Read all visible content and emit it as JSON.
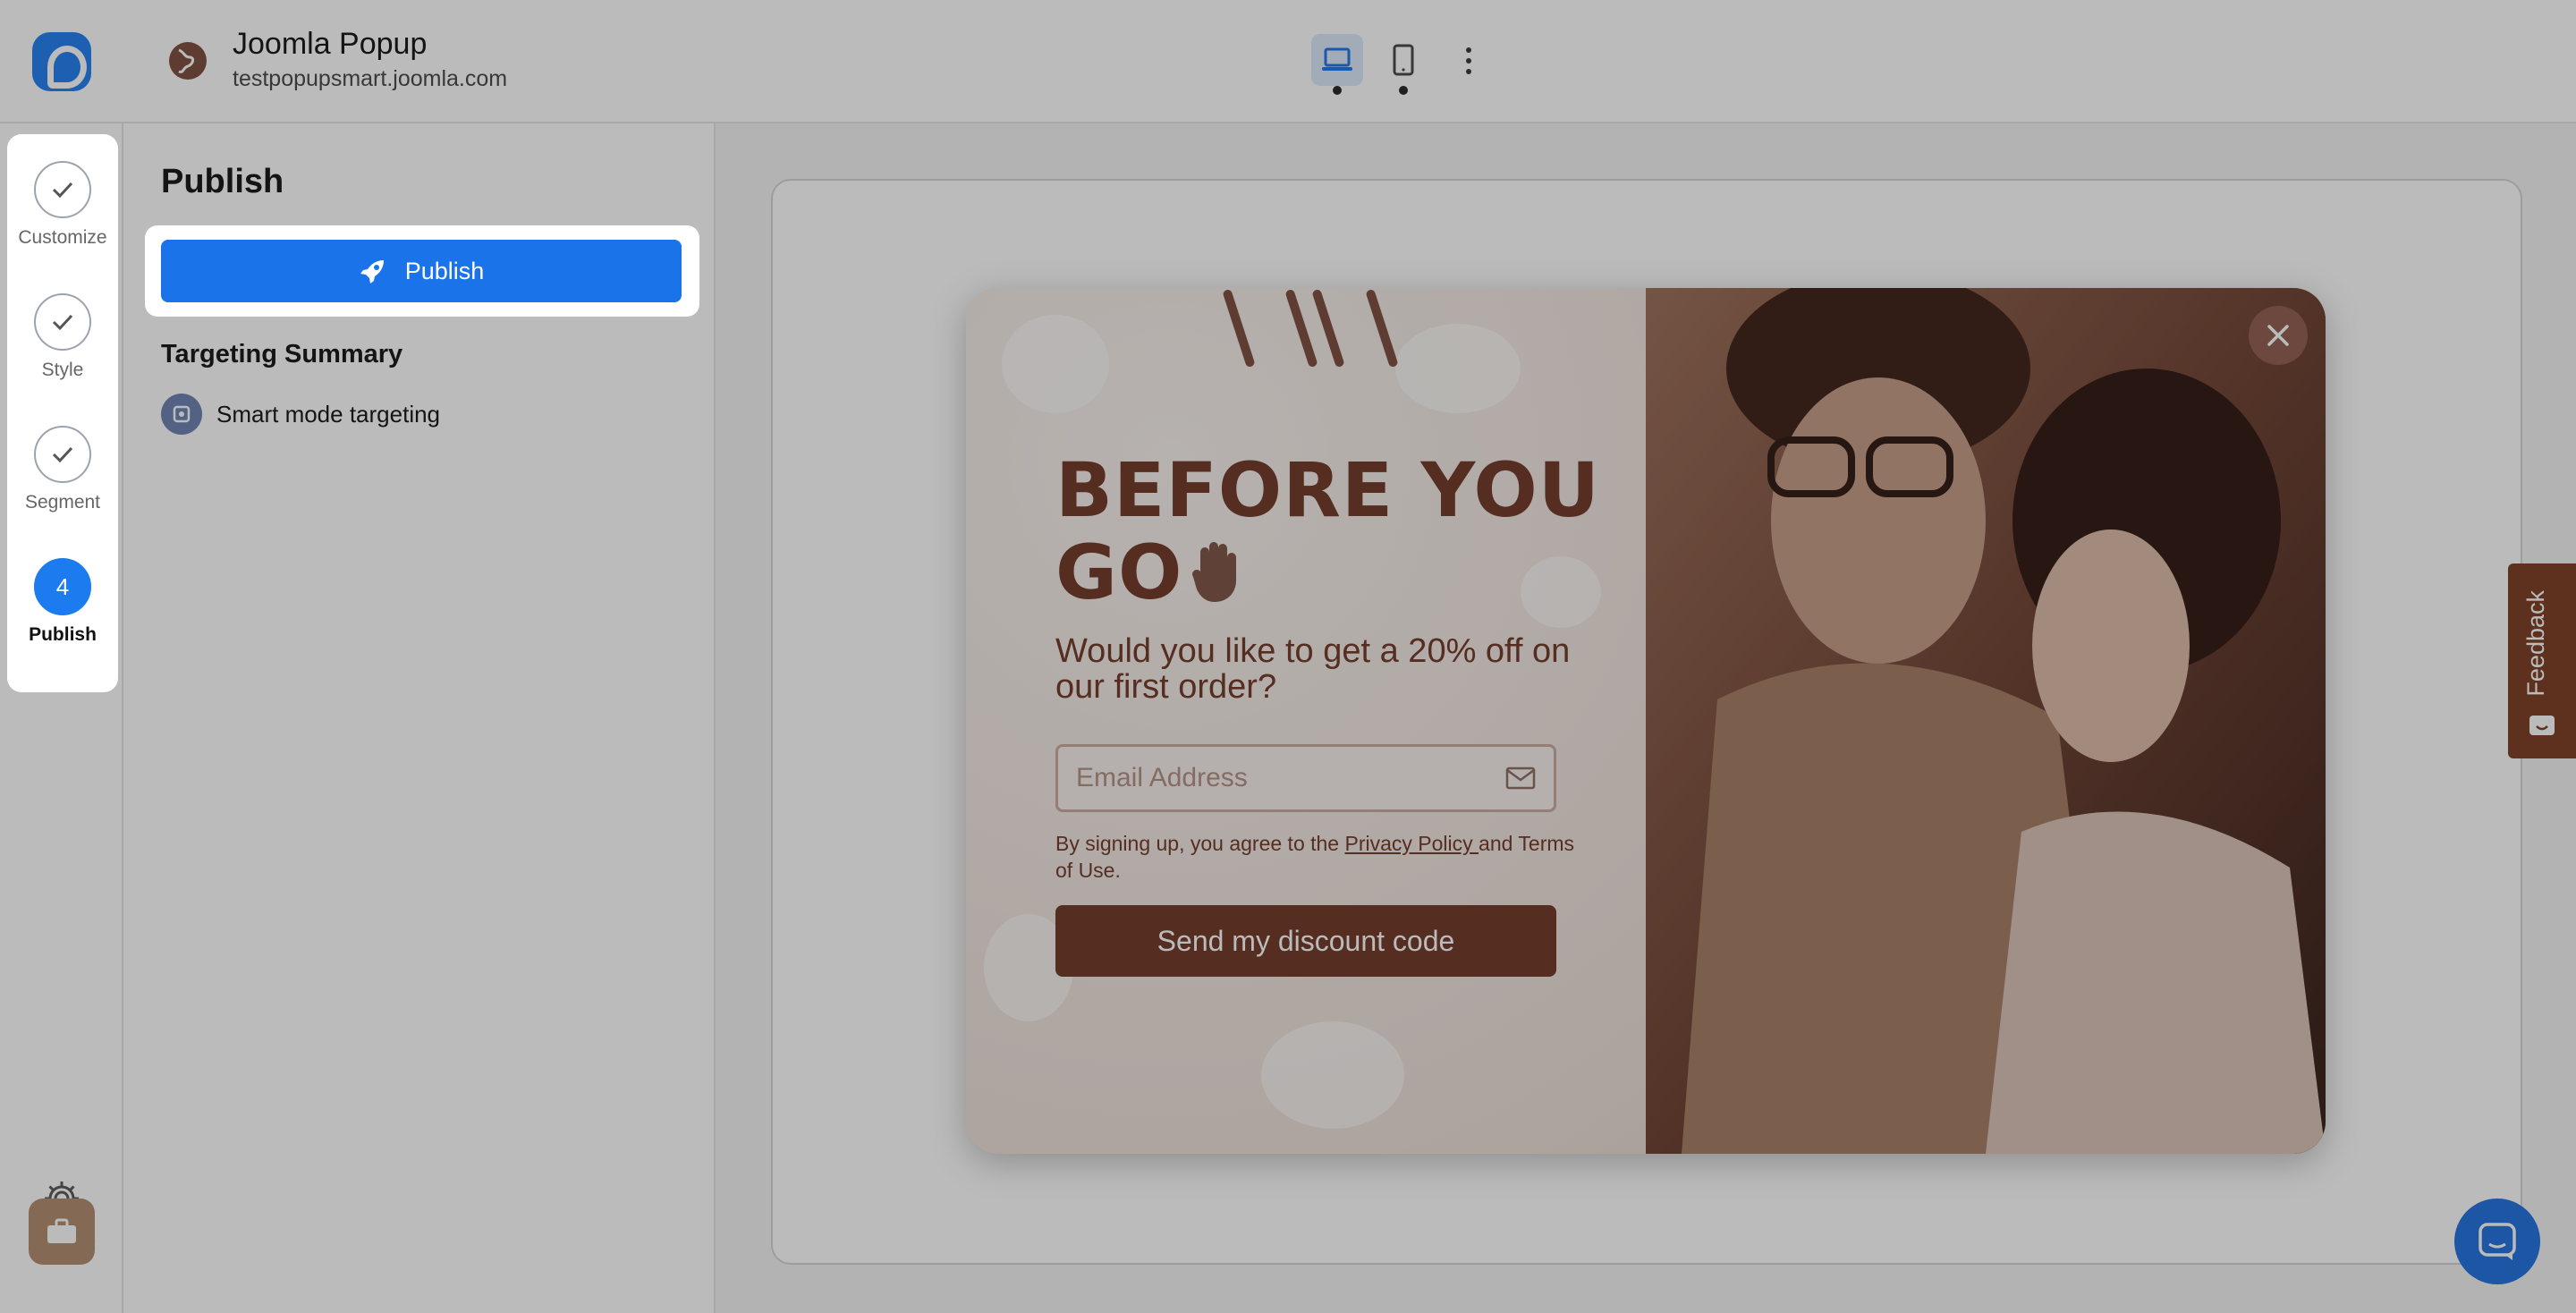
{
  "header": {
    "title": "Joomla Popup",
    "domain": "testpopupsmart.joomla.com"
  },
  "steps": [
    {
      "label": "Customize",
      "state": "done"
    },
    {
      "label": "Style",
      "state": "done"
    },
    {
      "label": "Segment",
      "state": "done"
    },
    {
      "label": "Publish",
      "state": "active",
      "number": "4"
    }
  ],
  "sidebar": {
    "settings_label": "Settings"
  },
  "panel": {
    "title": "Publish",
    "publish_button": "Publish",
    "targeting_title": "Targeting Summary",
    "targeting_item": "Smart mode targeting"
  },
  "popup": {
    "headline_line1": "BEFORE YOU",
    "headline_line2": "GO",
    "subheadline": "Would you like to get a 20% off on our first order?",
    "email_placeholder": "Email Address",
    "legal_prefix": "By signing up, you agree to the ",
    "legal_link": "Privacy Policy ",
    "legal_suffix": "and Terms of Use.",
    "cta": "Send my discount code"
  },
  "feedback_label": "Feedback",
  "colors": {
    "primary": "#1a73e8",
    "popup_brown": "#6e3423",
    "feedback_bg": "#7a3a20"
  }
}
